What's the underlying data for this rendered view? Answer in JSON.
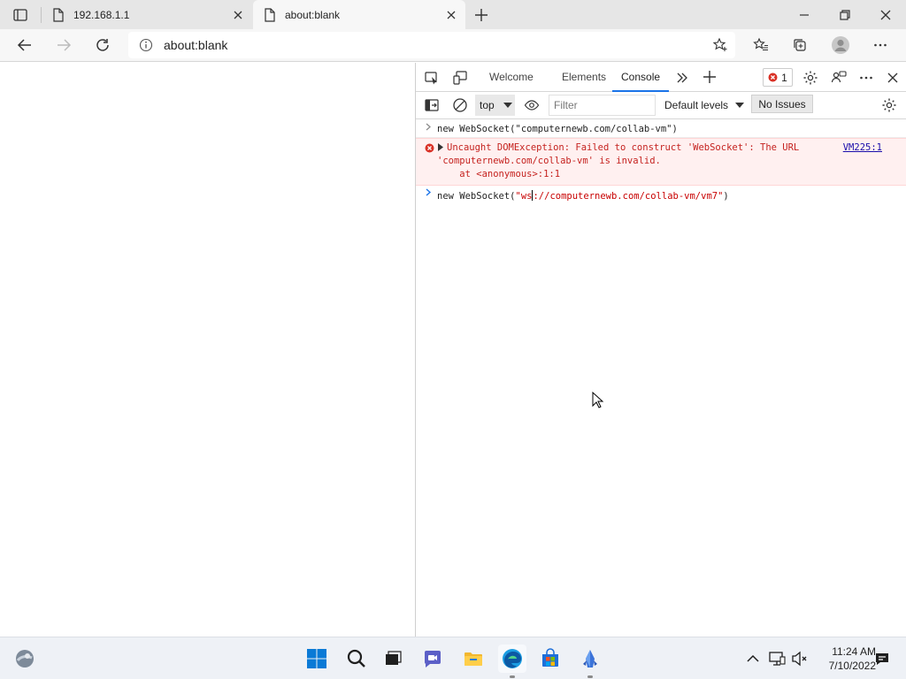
{
  "browser": {
    "tabs": [
      {
        "title": "192.168.1.1",
        "active": false
      },
      {
        "title": "about:blank",
        "active": true
      }
    ],
    "address_bar": {
      "url": "about:blank"
    }
  },
  "devtools": {
    "tabs": [
      {
        "label": "Welcome"
      },
      {
        "label": "Elements"
      },
      {
        "label": "Console",
        "active": true
      }
    ],
    "error_count": "1",
    "toolbar": {
      "context": "top",
      "filter_placeholder": "Filter",
      "levels": "Default levels",
      "issues": "No Issues"
    },
    "console": {
      "entry1": "new WebSocket(\"computernewb.com/collab-vm\")",
      "error_line1": "Uncaught DOMException: Failed to construct 'WebSocket': The URL",
      "error_line2": "'computernewb.com/collab-vm' is invalid.",
      "error_line3": "    at <anonymous>:1:1",
      "error_source": "VM225:1",
      "input_prefix": "new WebSocket(",
      "input_string_start": "\"ws",
      "input_string_end": "://computernewb.com/collab-vm/vm7\"",
      "input_suffix": ")"
    }
  },
  "taskbar": {
    "time": "11:24 AM",
    "date": "7/10/2022"
  },
  "colors": {
    "accent": "#1a73e8",
    "error_bg": "#fff0f0",
    "error_text": "#c5221f"
  }
}
